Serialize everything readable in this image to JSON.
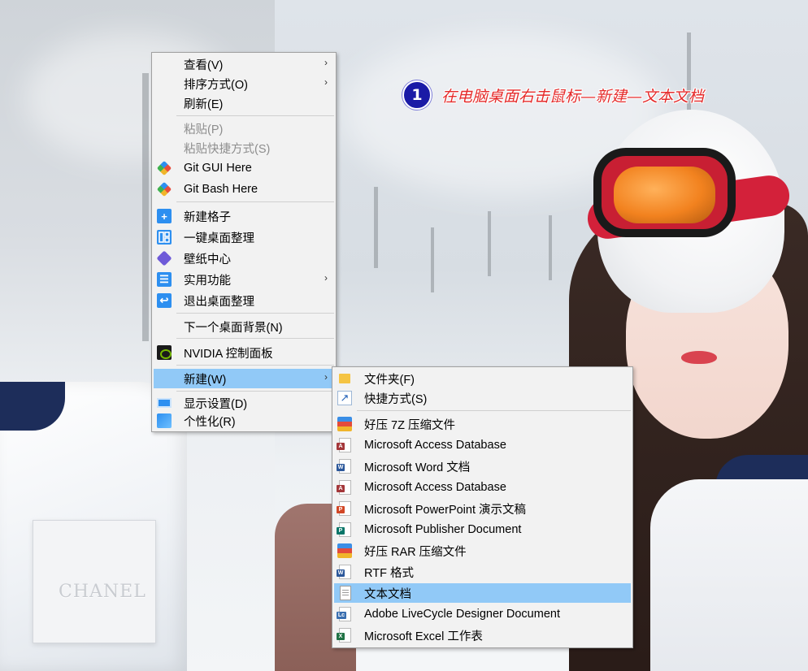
{
  "annotation": {
    "step_number": "1",
    "text": "在电脑桌面右击鼠标—新建—文本文档"
  },
  "wallpaper": {
    "patch_text": "CHANEL"
  },
  "context_menu": {
    "items": [
      {
        "label": "查看(V)",
        "submenu": "›"
      },
      {
        "label": "排序方式(O)",
        "submenu": "›"
      },
      {
        "label": "刷新(E)"
      },
      {
        "label": "粘贴(P)",
        "disabled": true
      },
      {
        "label": "粘贴快捷方式(S)",
        "disabled": true
      },
      {
        "label": "Git GUI Here",
        "icon": "git-gui-icon"
      },
      {
        "label": "Git Bash Here",
        "icon": "git-bash-icon"
      },
      {
        "label": "新建格子",
        "icon": "plus-icon"
      },
      {
        "label": "一键桌面整理",
        "icon": "grid-layout-icon"
      },
      {
        "label": "壁纸中心",
        "icon": "cube-icon"
      },
      {
        "label": "实用功能",
        "icon": "list-icon",
        "submenu": "›"
      },
      {
        "label": "退出桌面整理",
        "icon": "exit-icon"
      },
      {
        "label": "下一个桌面背景(N)"
      },
      {
        "label": "NVIDIA 控制面板",
        "icon": "nvidia-icon"
      },
      {
        "label": "新建(W)",
        "submenu": "›",
        "highlighted": true
      },
      {
        "label": "显示设置(D)",
        "icon": "display-icon"
      },
      {
        "label": "个性化(R)",
        "icon": "personalize-icon"
      }
    ],
    "icon_glyphs": {
      "plus": "+",
      "grid": "",
      "list": "☰",
      "exit": "↩"
    }
  },
  "new_submenu": {
    "items": [
      {
        "label": "文件夹(F)",
        "icon": "folder-icon"
      },
      {
        "label": "快捷方式(S)",
        "icon": "shortcut-icon"
      },
      {
        "label": "好压 7Z 压缩文件",
        "icon": "7z-archive-icon"
      },
      {
        "label": "Microsoft Access Database",
        "icon": "access-icon"
      },
      {
        "label": "Microsoft Word 文档",
        "icon": "word-icon"
      },
      {
        "label": "Microsoft Access Database",
        "icon": "access-icon"
      },
      {
        "label": "Microsoft PowerPoint 演示文稿",
        "icon": "powerpoint-icon"
      },
      {
        "label": "Microsoft Publisher Document",
        "icon": "publisher-icon"
      },
      {
        "label": "好压 RAR 压缩文件",
        "icon": "rar-archive-icon"
      },
      {
        "label": "RTF 格式",
        "icon": "rtf-icon"
      },
      {
        "label": "文本文档",
        "icon": "text-document-icon",
        "highlighted": true
      },
      {
        "label": "Adobe LiveCycle Designer Document",
        "icon": "livecycle-icon"
      },
      {
        "label": "Microsoft Excel 工作表",
        "icon": "excel-icon"
      }
    ],
    "icon_tags": {
      "access": "A",
      "word": "W",
      "powerpoint": "P",
      "publisher": "P",
      "rtf": "W",
      "livecycle": "Lc",
      "excel": "X",
      "shortcut": "↗"
    },
    "colors": {
      "access": "#a4373a",
      "word": "#2b579a",
      "powerpoint": "#d24726",
      "publisher": "#077568",
      "rtf": "#2b579a",
      "livecycle": "#3a6fb0",
      "excel": "#217346"
    }
  },
  "colors": {
    "highlight": "#91c9f7",
    "annotation_text": "#e52b2b",
    "annotation_badge": "#1a1aa6"
  }
}
